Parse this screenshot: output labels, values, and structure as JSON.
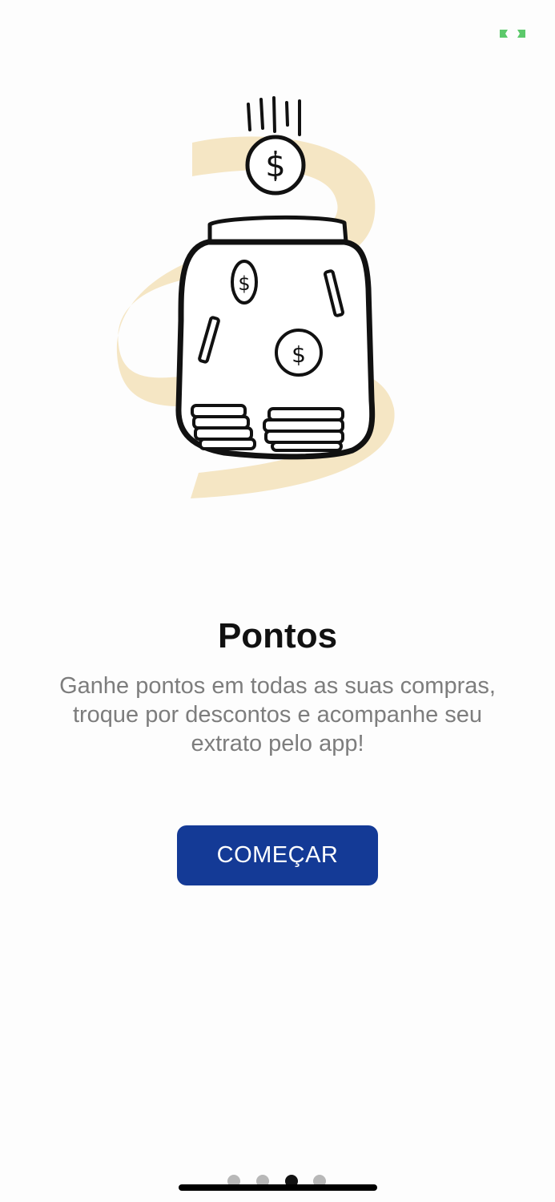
{
  "status": {
    "icon": "battery-charging-icon",
    "color": "#5cc96b"
  },
  "illustration": {
    "icon": "coin-jar-icon",
    "accent_color": "#f5e6c4"
  },
  "onboarding": {
    "title": "Pontos",
    "description": "Ganhe pontos em todas as suas compras, troque por descontos e acompanhe seu extrato pelo app!",
    "cta_label": "COMEÇAR",
    "cta_color": "#143a96"
  },
  "pager": {
    "total_pages": 4,
    "current_page": 3
  }
}
